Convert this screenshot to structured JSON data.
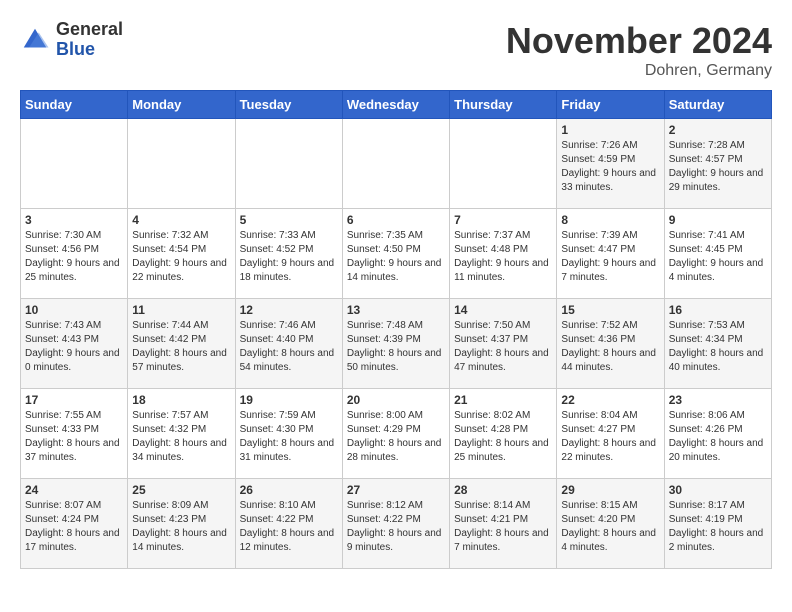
{
  "header": {
    "logo_general": "General",
    "logo_blue": "Blue",
    "month_title": "November 2024",
    "subtitle": "Dohren, Germany"
  },
  "weekdays": [
    "Sunday",
    "Monday",
    "Tuesday",
    "Wednesday",
    "Thursday",
    "Friday",
    "Saturday"
  ],
  "weeks": [
    [
      {
        "day": "",
        "info": ""
      },
      {
        "day": "",
        "info": ""
      },
      {
        "day": "",
        "info": ""
      },
      {
        "day": "",
        "info": ""
      },
      {
        "day": "",
        "info": ""
      },
      {
        "day": "1",
        "info": "Sunrise: 7:26 AM\nSunset: 4:59 PM\nDaylight: 9 hours and 33 minutes."
      },
      {
        "day": "2",
        "info": "Sunrise: 7:28 AM\nSunset: 4:57 PM\nDaylight: 9 hours and 29 minutes."
      }
    ],
    [
      {
        "day": "3",
        "info": "Sunrise: 7:30 AM\nSunset: 4:56 PM\nDaylight: 9 hours and 25 minutes."
      },
      {
        "day": "4",
        "info": "Sunrise: 7:32 AM\nSunset: 4:54 PM\nDaylight: 9 hours and 22 minutes."
      },
      {
        "day": "5",
        "info": "Sunrise: 7:33 AM\nSunset: 4:52 PM\nDaylight: 9 hours and 18 minutes."
      },
      {
        "day": "6",
        "info": "Sunrise: 7:35 AM\nSunset: 4:50 PM\nDaylight: 9 hours and 14 minutes."
      },
      {
        "day": "7",
        "info": "Sunrise: 7:37 AM\nSunset: 4:48 PM\nDaylight: 9 hours and 11 minutes."
      },
      {
        "day": "8",
        "info": "Sunrise: 7:39 AM\nSunset: 4:47 PM\nDaylight: 9 hours and 7 minutes."
      },
      {
        "day": "9",
        "info": "Sunrise: 7:41 AM\nSunset: 4:45 PM\nDaylight: 9 hours and 4 minutes."
      }
    ],
    [
      {
        "day": "10",
        "info": "Sunrise: 7:43 AM\nSunset: 4:43 PM\nDaylight: 9 hours and 0 minutes."
      },
      {
        "day": "11",
        "info": "Sunrise: 7:44 AM\nSunset: 4:42 PM\nDaylight: 8 hours and 57 minutes."
      },
      {
        "day": "12",
        "info": "Sunrise: 7:46 AM\nSunset: 4:40 PM\nDaylight: 8 hours and 54 minutes."
      },
      {
        "day": "13",
        "info": "Sunrise: 7:48 AM\nSunset: 4:39 PM\nDaylight: 8 hours and 50 minutes."
      },
      {
        "day": "14",
        "info": "Sunrise: 7:50 AM\nSunset: 4:37 PM\nDaylight: 8 hours and 47 minutes."
      },
      {
        "day": "15",
        "info": "Sunrise: 7:52 AM\nSunset: 4:36 PM\nDaylight: 8 hours and 44 minutes."
      },
      {
        "day": "16",
        "info": "Sunrise: 7:53 AM\nSunset: 4:34 PM\nDaylight: 8 hours and 40 minutes."
      }
    ],
    [
      {
        "day": "17",
        "info": "Sunrise: 7:55 AM\nSunset: 4:33 PM\nDaylight: 8 hours and 37 minutes."
      },
      {
        "day": "18",
        "info": "Sunrise: 7:57 AM\nSunset: 4:32 PM\nDaylight: 8 hours and 34 minutes."
      },
      {
        "day": "19",
        "info": "Sunrise: 7:59 AM\nSunset: 4:30 PM\nDaylight: 8 hours and 31 minutes."
      },
      {
        "day": "20",
        "info": "Sunrise: 8:00 AM\nSunset: 4:29 PM\nDaylight: 8 hours and 28 minutes."
      },
      {
        "day": "21",
        "info": "Sunrise: 8:02 AM\nSunset: 4:28 PM\nDaylight: 8 hours and 25 minutes."
      },
      {
        "day": "22",
        "info": "Sunrise: 8:04 AM\nSunset: 4:27 PM\nDaylight: 8 hours and 22 minutes."
      },
      {
        "day": "23",
        "info": "Sunrise: 8:06 AM\nSunset: 4:26 PM\nDaylight: 8 hours and 20 minutes."
      }
    ],
    [
      {
        "day": "24",
        "info": "Sunrise: 8:07 AM\nSunset: 4:24 PM\nDaylight: 8 hours and 17 minutes."
      },
      {
        "day": "25",
        "info": "Sunrise: 8:09 AM\nSunset: 4:23 PM\nDaylight: 8 hours and 14 minutes."
      },
      {
        "day": "26",
        "info": "Sunrise: 8:10 AM\nSunset: 4:22 PM\nDaylight: 8 hours and 12 minutes."
      },
      {
        "day": "27",
        "info": "Sunrise: 8:12 AM\nSunset: 4:22 PM\nDaylight: 8 hours and 9 minutes."
      },
      {
        "day": "28",
        "info": "Sunrise: 8:14 AM\nSunset: 4:21 PM\nDaylight: 8 hours and 7 minutes."
      },
      {
        "day": "29",
        "info": "Sunrise: 8:15 AM\nSunset: 4:20 PM\nDaylight: 8 hours and 4 minutes."
      },
      {
        "day": "30",
        "info": "Sunrise: 8:17 AM\nSunset: 4:19 PM\nDaylight: 8 hours and 2 minutes."
      }
    ]
  ]
}
